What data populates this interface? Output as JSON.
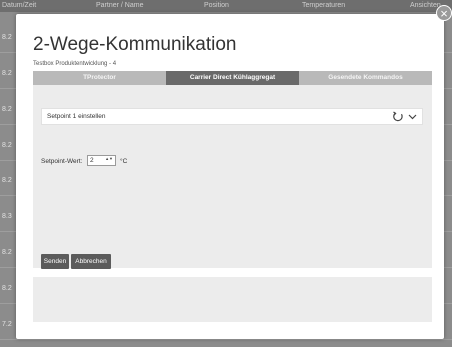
{
  "background": {
    "header_columns": [
      "Datum/Zeit",
      "Partner / Name",
      "Position",
      "Temperaturen",
      "Ansichten"
    ],
    "row_values": [
      "8.2",
      "8.2",
      "8.2",
      "8.2",
      "8.2",
      "8.3",
      "8.2",
      "8.2",
      "7.2"
    ]
  },
  "modal": {
    "close_symbol": "×",
    "title": "2-Wege-Kommunikation",
    "subtitle": "Testbox Produktentwicklung - 4",
    "tabs": [
      {
        "label": "TProtector",
        "active": false
      },
      {
        "label": "Carrier Direct Kühlaggregat",
        "active": true
      },
      {
        "label": "Gesendete Kommandos",
        "active": false
      }
    ],
    "command_select": {
      "value": "Setpoint 1 einstellen",
      "icons": [
        "refresh-icon",
        "chevron-down-icon"
      ]
    },
    "setpoint": {
      "label": "Setpoint-Wert:",
      "value": "2",
      "stepper_symbol": "▲▼",
      "unit": "°C"
    },
    "buttons": {
      "send": "Senden",
      "cancel": "Abbrechen"
    }
  },
  "colors": {
    "active_tab": "#6a6a6a",
    "tab_bar": "#b9b9b9",
    "button": "#5b5b5b",
    "panel": "#ececec",
    "overlay": "#8c8c8c"
  }
}
